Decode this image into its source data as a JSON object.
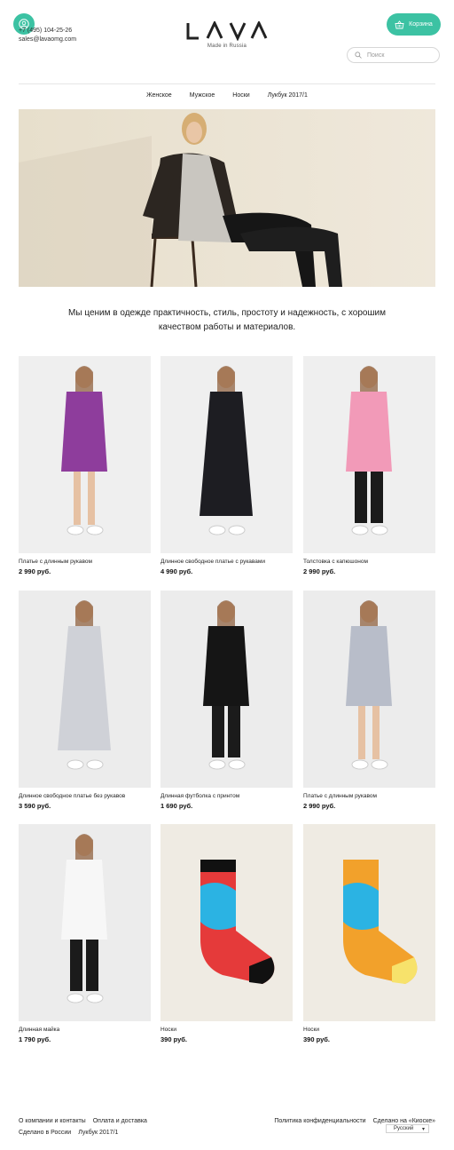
{
  "header": {
    "phone": "+7 (495) 104-25-26",
    "email": "sales@lavaomg.com",
    "logo_text": "LAVA",
    "tagline": "Made in Russia",
    "cart_label": "Корзина",
    "search_placeholder": "Поиск",
    "accent_color": "#3cc2a3"
  },
  "nav": [
    {
      "label": "Женское"
    },
    {
      "label": "Мужское"
    },
    {
      "label": "Носки"
    },
    {
      "label": "Лукбук 2017/1"
    }
  ],
  "intro": {
    "text": "Мы ценим в одежде практичность, стиль, простоту и надежность, с хорошим качеством работы и материалов."
  },
  "products": [
    {
      "name": "Платье с длинным рукавом",
      "price": "2 990 руб.",
      "color": "#8e3d9c"
    },
    {
      "name": "Длинное свободное платье с рукавами",
      "price": "4 990 руб.",
      "color": "#1d1d22"
    },
    {
      "name": "Толстовка с капюшоном",
      "price": "2 990 руб.",
      "color": "#f29ab8"
    },
    {
      "name": "Длинное свободное платье без рукавов",
      "price": "3 590 руб.",
      "color": "#cfd1d7"
    },
    {
      "name": "Длинная футболка с принтом",
      "price": "1 690 руб.",
      "color": "#151515"
    },
    {
      "name": "Платье с длинным рукавом",
      "price": "2 990 руб.",
      "color": "#b8bdc9"
    },
    {
      "name": "Длинная майка",
      "price": "1 790 руб.",
      "color": "#f7f7f7"
    },
    {
      "name": "Носки",
      "price": "390 руб.",
      "color": "#e53a3a"
    },
    {
      "name": "Носки",
      "price": "390 руб.",
      "color": "#f2a12b"
    }
  ],
  "footer": {
    "about": "О компании и контакты",
    "payment": "Оплата и доставка",
    "made_in": "Сделано в России",
    "lookbook": "Лукбук 2017/1",
    "privacy": "Политика конфиденциальности",
    "kiosk": "Сделано на «Киоске»",
    "language": "Русский"
  }
}
